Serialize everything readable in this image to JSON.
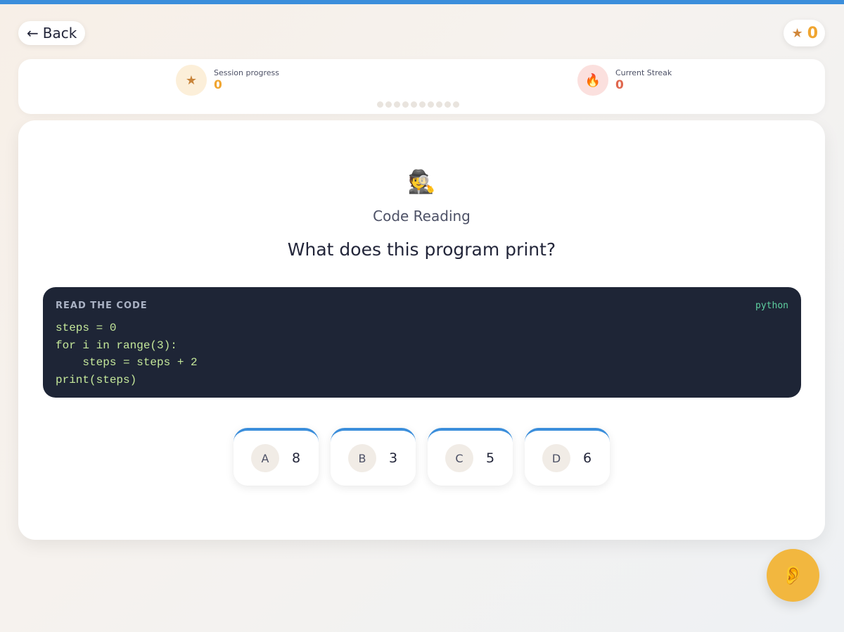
{
  "header": {
    "back_label": "Back",
    "score": "0"
  },
  "stats": {
    "session_label": "Session progress",
    "session_value": "0",
    "streak_label": "Current Streak",
    "streak_value": "0",
    "progress_dots_total": 10
  },
  "quiz": {
    "mode_emoji": "🕵️",
    "mode_title": "Code Reading",
    "question": "What does this program print?",
    "code": {
      "title": "READ THE CODE",
      "language": "python",
      "lines": "steps = 0\nfor i in range(3):\n    steps = steps + 2\nprint(steps)"
    },
    "answers": [
      {
        "letter": "A",
        "value": "8"
      },
      {
        "letter": "B",
        "value": "3"
      },
      {
        "letter": "C",
        "value": "5"
      },
      {
        "letter": "D",
        "value": "6"
      }
    ]
  },
  "colors": {
    "accent": "#3b8edb",
    "score": "#f0a530",
    "streak": "#e0674e",
    "listen_button": "#f2b73f"
  },
  "icons": {
    "back": "arrow-left-icon",
    "score": "star-icon",
    "session": "star-icon",
    "streak": "flame-icon",
    "listen": "ear-icon"
  }
}
